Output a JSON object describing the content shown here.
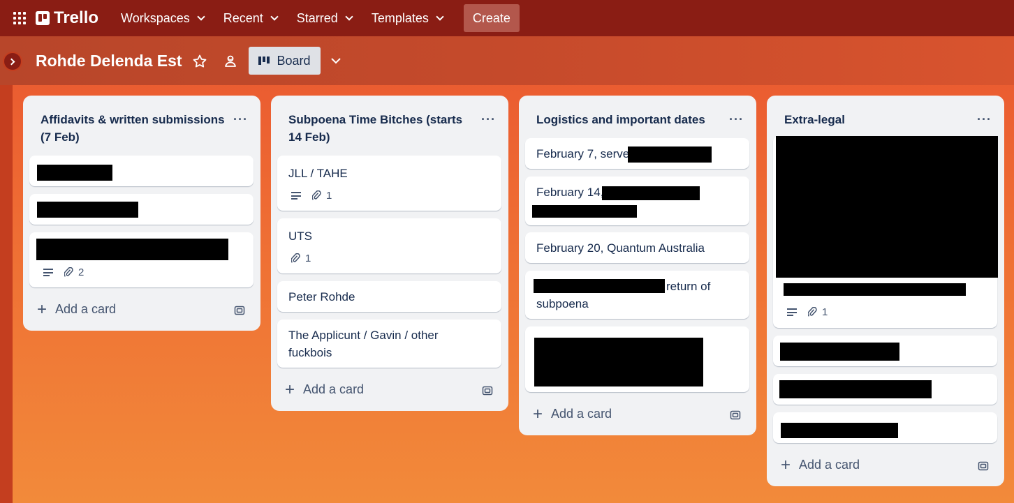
{
  "topbar": {
    "logo": "Trello",
    "nav": [
      "Workspaces",
      "Recent",
      "Starred",
      "Templates"
    ],
    "create_label": "Create"
  },
  "board": {
    "title": "Rohde Delenda Est",
    "view_label": "Board"
  },
  "lists": [
    {
      "title": "Affidavits & written submissions (7 Feb)",
      "add_card": "Add a card",
      "cards": [
        {
          "text": "",
          "redacted": true
        },
        {
          "text": "",
          "redacted": true
        },
        {
          "text": "",
          "redacted": true,
          "attachments": "2"
        }
      ]
    },
    {
      "title": "Subpoena Time Bitches (starts 14 Feb)",
      "add_card": "Add a card",
      "cards": [
        {
          "text": "JLL / TAHE",
          "attachments": "1"
        },
        {
          "text": "UTS",
          "attachments": "1"
        },
        {
          "text": "Peter Rohde"
        },
        {
          "text": "The Applicunt / Gavin / other fuckbois"
        }
      ]
    },
    {
      "title": "Logistics and important dates",
      "add_card": "Add a card",
      "cards": [
        {
          "text": "February 7, serve"
        },
        {
          "text": "February 14,"
        },
        {
          "text": "February 20, Quantum Australia"
        },
        {
          "text": "return of subpoena"
        },
        {
          "text": "",
          "redacted": true
        }
      ]
    },
    {
      "title": "Extra-legal",
      "add_card": "Add a card",
      "cards": [
        {
          "text": "",
          "redacted": true,
          "attachments": "1"
        },
        {
          "text": "",
          "redacted": true
        },
        {
          "text": "",
          "redacted": true
        },
        {
          "text": "",
          "redacted": true
        }
      ]
    }
  ]
}
